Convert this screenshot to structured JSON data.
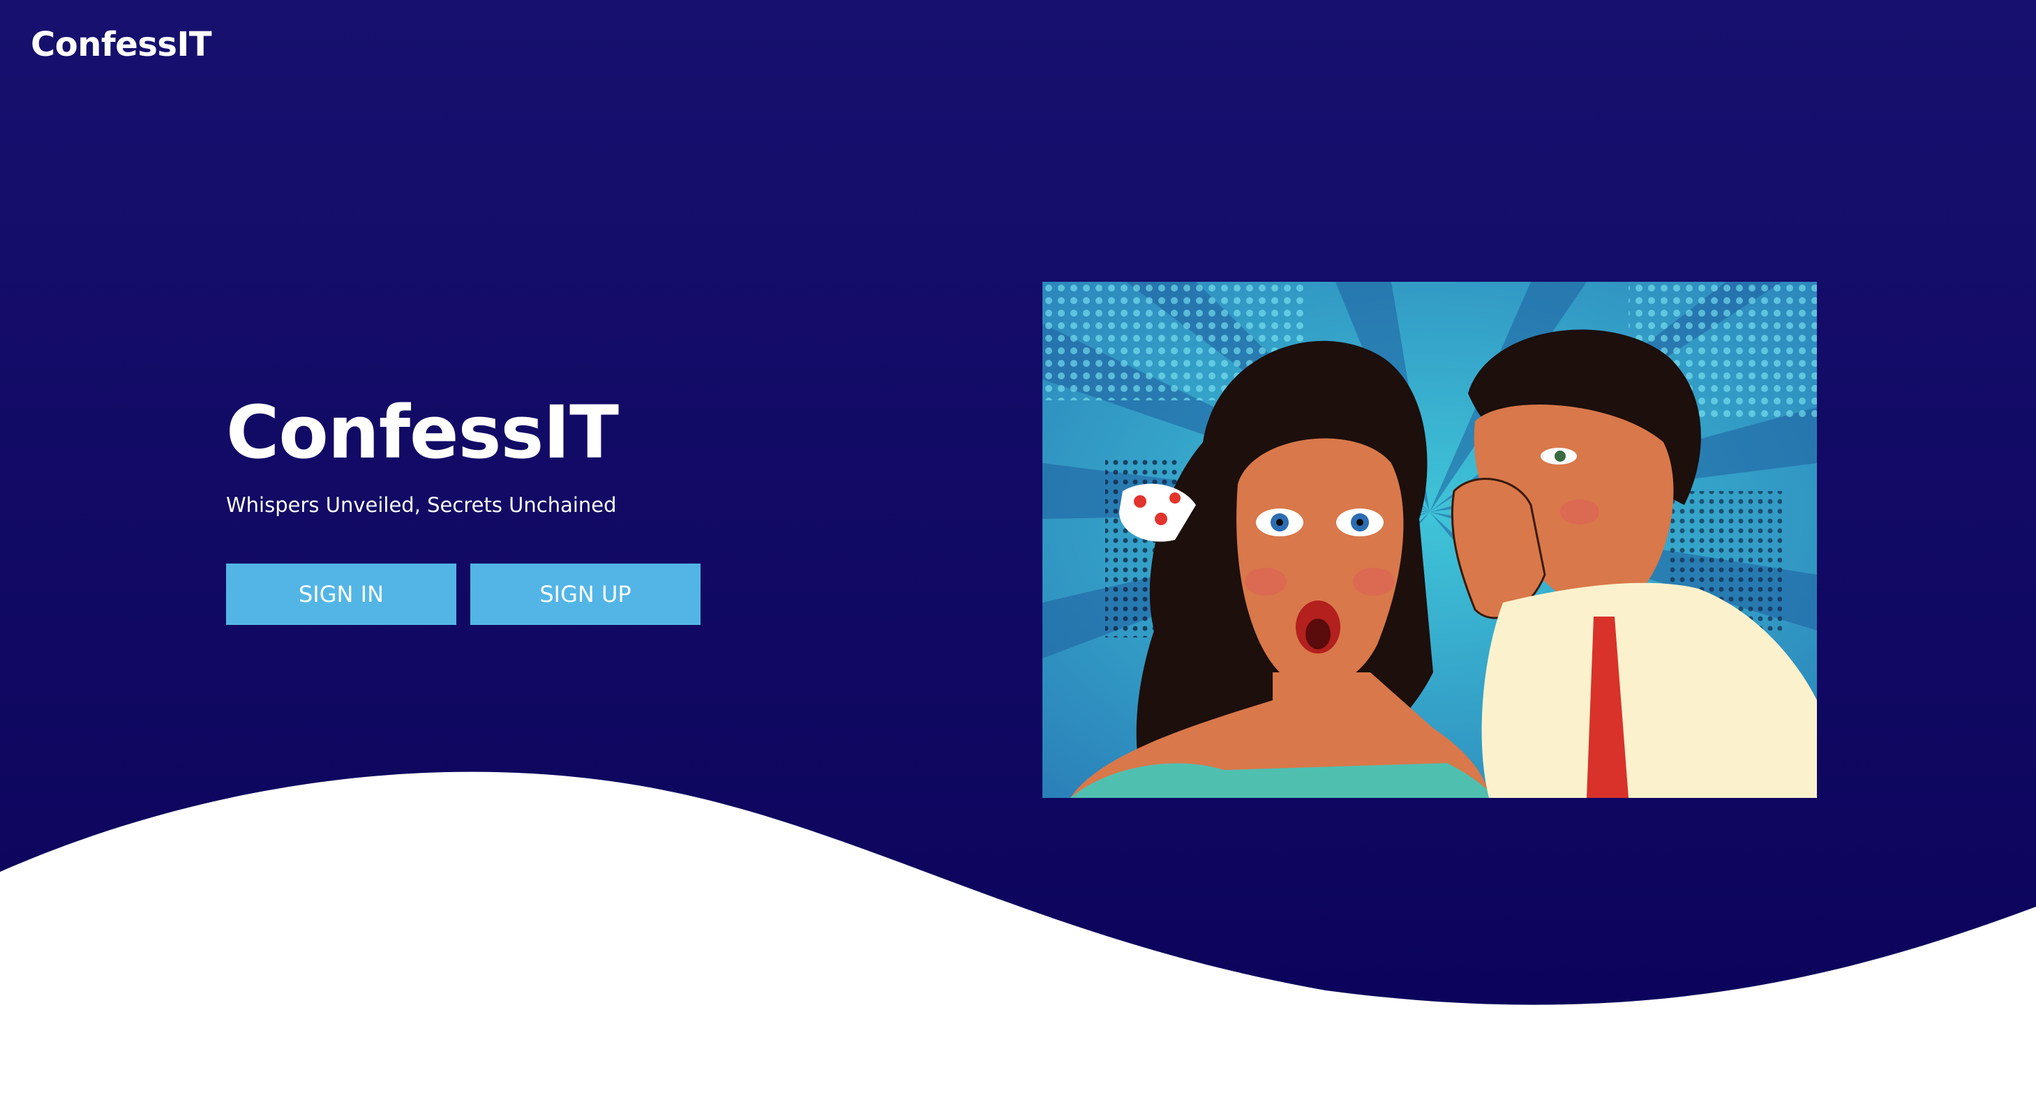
{
  "header": {
    "brand": "ConfessIT"
  },
  "hero": {
    "title": "ConfessIT",
    "tagline": "Whispers Unveiled, Secrets Unchained",
    "buttons": {
      "sign_in": "SIGN IN",
      "sign_up": "SIGN UP"
    },
    "illustration": "pop-art-whisper-illustration"
  },
  "colors": {
    "background": "#120b6e",
    "button": "#52b5e6",
    "text": "#ffffff"
  }
}
